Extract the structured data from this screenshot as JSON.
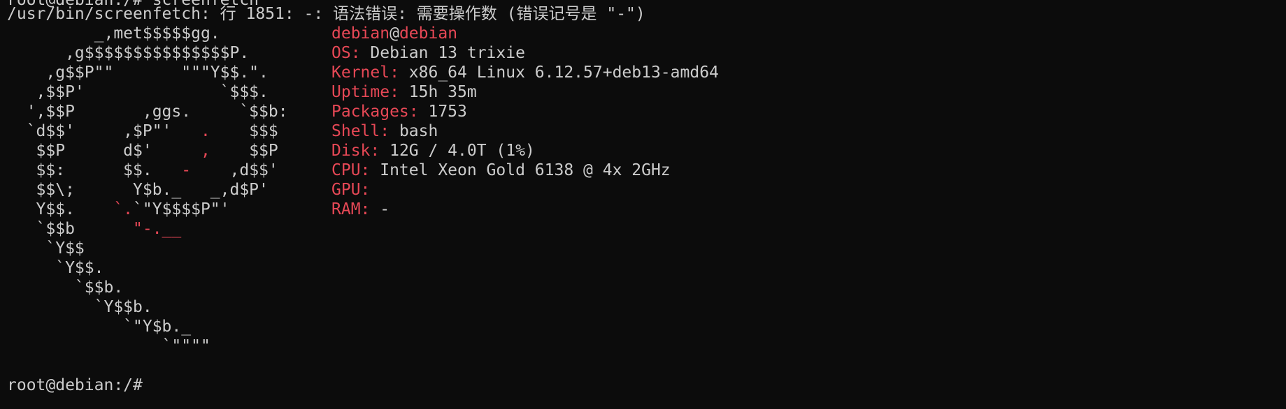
{
  "terminal": {
    "prev_prompt": "root@debian:/# screenfetch",
    "error_line": "/usr/bin/screenfetch: 行 1851: -: 语法错误: 需要操作数 (错误记号是 \"-\")",
    "prompt": "root@debian:/#"
  },
  "logo": [
    {
      "w": "         _,met$$$$$gg."
    },
    {
      "w": "      ,g$$$$$$$$$$$$$$$P."
    },
    {
      "w": "    ,g$$P\"\"       \"\"\"Y$$.\"."
    },
    {
      "w": "   ,$$P'              `$$$."
    },
    {
      "w": "  ',$$P       ,ggs.     `$$b:"
    },
    {
      "w": "  `d$$'     ,$P\"'   ",
      "r": ".",
      "w2": "    $$$"
    },
    {
      "w": "   $$P      d$'     ",
      "r": ",",
      "w2": "    $$P"
    },
    {
      "w": "   $$:      $$.   ",
      "r": "-",
      "w2": "    ,d$$'"
    },
    {
      "w": "   $$\\;      Y$b._   _,d$P'"
    },
    {
      "w": "   Y$$.    ",
      "r": "`.",
      "w2": "`\"Y$$$$P\"'"
    },
    {
      "w": "   `$$b      ",
      "r": "\"-.__"
    },
    {
      "w": "    `Y$$"
    },
    {
      "w": "     `Y$$."
    },
    {
      "w": "       `$$b."
    },
    {
      "w": "         `Y$$b."
    },
    {
      "w": "            `\"Y$b._"
    },
    {
      "w": "                `\"\"\"\""
    }
  ],
  "sysinfo": {
    "user": "debian",
    "at": "@",
    "host": "debian",
    "rows": [
      {
        "label": "OS:",
        "value": " Debian 13 trixie"
      },
      {
        "label": "Kernel:",
        "value": " x86_64 Linux 6.12.57+deb13-amd64"
      },
      {
        "label": "Uptime:",
        "value": " 15h 35m"
      },
      {
        "label": "Packages:",
        "value": " 1753"
      },
      {
        "label": "Shell:",
        "value": " bash"
      },
      {
        "label": "Disk:",
        "value": " 12G / 4.0T (1%)"
      },
      {
        "label": "CPU:",
        "value": " Intel Xeon Gold 6138 @ 4x 2GHz"
      },
      {
        "label": "GPU:",
        "value": ""
      },
      {
        "label": "RAM:",
        "value": " -"
      }
    ]
  },
  "colors": {
    "background": "#0c0c0c",
    "foreground": "#cccccc",
    "accent_red": "#e74856"
  }
}
